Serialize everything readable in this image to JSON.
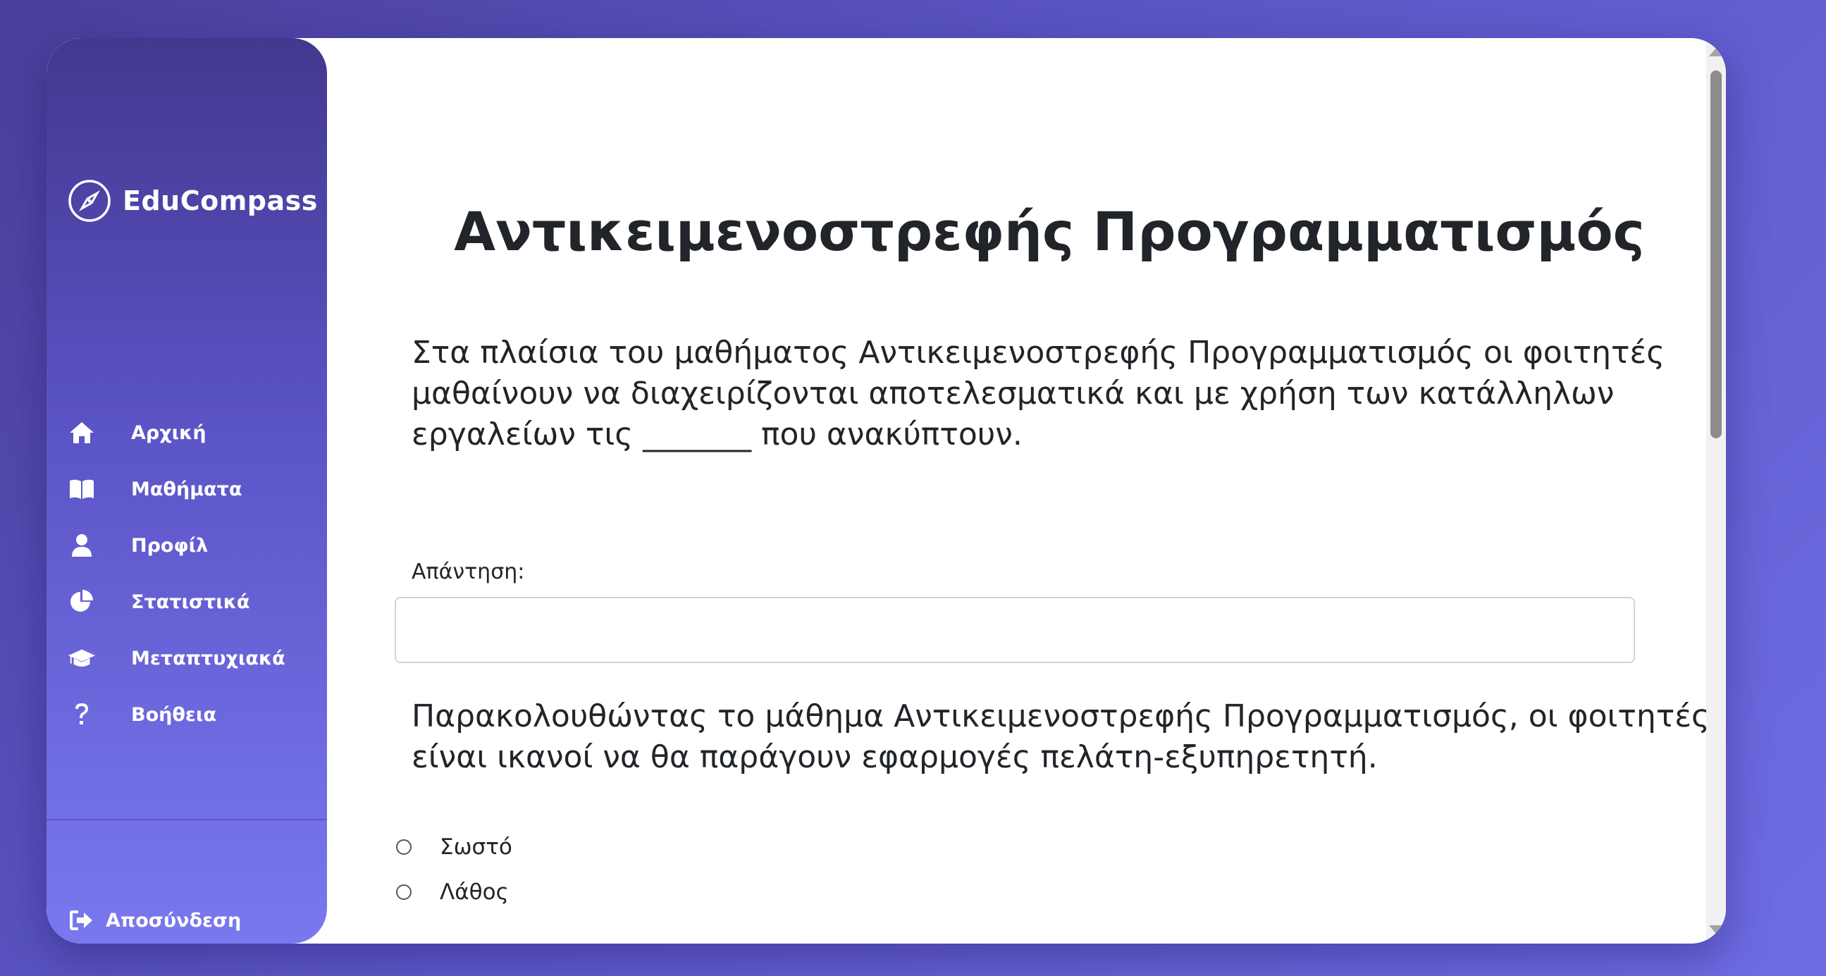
{
  "app": {
    "name": "EduCompass"
  },
  "sidebar": {
    "items": [
      {
        "label": "Αρχική",
        "icon": "home-icon"
      },
      {
        "label": "Μαθήματα",
        "icon": "book-open-icon"
      },
      {
        "label": "Προφίλ",
        "icon": "user-icon"
      },
      {
        "label": "Στατιστικά",
        "icon": "pie-chart-icon"
      },
      {
        "label": "Μεταπτυχιακά",
        "icon": "graduation-cap-icon"
      },
      {
        "label": "Βοήθεια",
        "icon": "question-icon"
      }
    ],
    "logout_label": "Αποσύνδεση"
  },
  "main": {
    "title": "Αντικειμενοστρεφής Προγραμματισμός",
    "question1": {
      "text": "Στα πλαίσια του μαθήματος Αντικειμενοστρεφής Προγραμματισμός οι φοιτητές μαθαίνουν να διαχειρίζονται αποτελεσματικά και με χρήση των κατάλληλων εργαλείων τις _______ που ανακύπτουν.",
      "answer_label": "Απάντηση:",
      "answer_value": "",
      "answer_placeholder": ""
    },
    "question2": {
      "text": "Παρακολουθώντας το μάθημα Αντικειμενοστρεφής Προγραμματισμός, οι φοιτητές είναι ικανοί να θα παράγουν εφαρμογές πελάτη-εξυπηρετητή.",
      "options": [
        "Σωστό",
        "Λάθος"
      ]
    }
  },
  "colors": {
    "sidebar_top": "#43388f",
    "sidebar_bottom": "#7a78ee",
    "background": "#5b55c4",
    "text": "#212529"
  }
}
